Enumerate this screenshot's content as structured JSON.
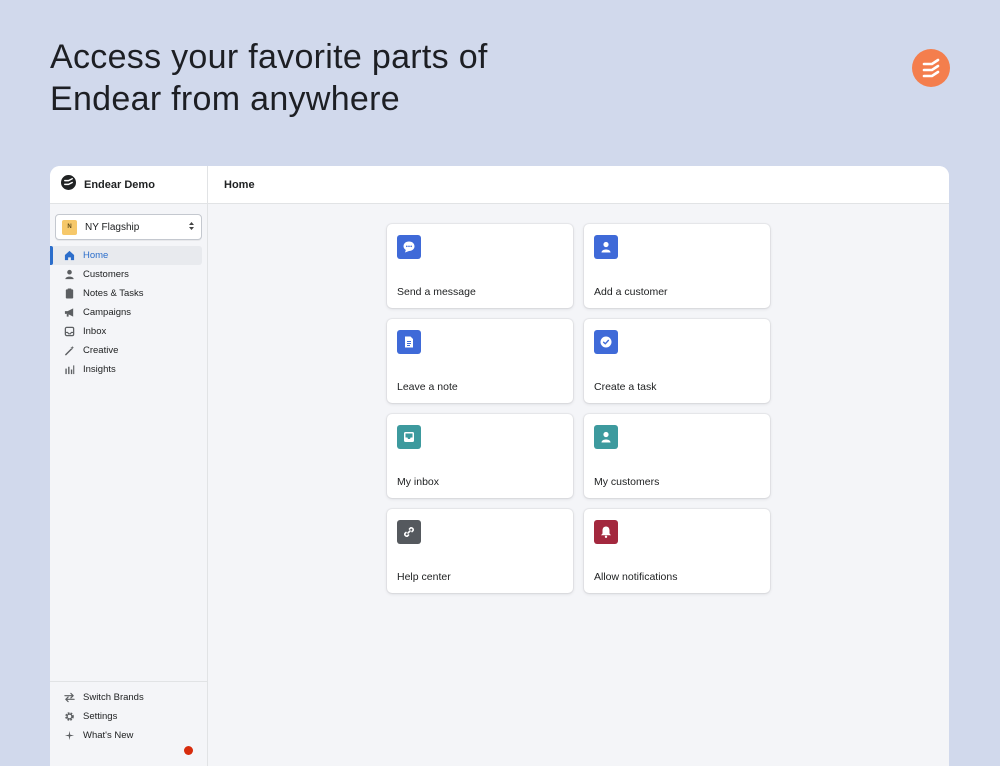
{
  "headline": {
    "line1": "Access your favorite parts of",
    "line2": "Endear from anywhere"
  },
  "brand_color": "#f47e4d",
  "sidebar": {
    "app_name": "Endear Demo",
    "store": {
      "initial": "N",
      "name": "NY Flagship"
    },
    "items": [
      {
        "label": "Home",
        "icon": "home-icon"
      },
      {
        "label": "Customers",
        "icon": "person-icon"
      },
      {
        "label": "Notes & Tasks",
        "icon": "clipboard-icon"
      },
      {
        "label": "Campaigns",
        "icon": "megaphone-icon"
      },
      {
        "label": "Inbox",
        "icon": "inbox-icon"
      },
      {
        "label": "Creative",
        "icon": "magic-wand-icon"
      },
      {
        "label": "Insights",
        "icon": "bar-chart-icon"
      }
    ],
    "footer_items": [
      {
        "label": "Switch Brands",
        "icon": "swap-arrows-icon"
      },
      {
        "label": "Settings",
        "icon": "gear-icon"
      },
      {
        "label": "What's New",
        "icon": "sparkle-icon"
      }
    ]
  },
  "main": {
    "title": "Home",
    "cards": [
      {
        "label": "Send a message",
        "icon": "chat-bubble-icon",
        "color": "#3f6ad8"
      },
      {
        "label": "Add a customer",
        "icon": "person-icon",
        "color": "#3f6ad8"
      },
      {
        "label": "Leave a note",
        "icon": "document-icon",
        "color": "#3f6ad8"
      },
      {
        "label": "Create a task",
        "icon": "checkmark-circle-icon",
        "color": "#3f6ad8"
      },
      {
        "label": "My inbox",
        "icon": "inbox-icon",
        "color": "#3d9a9e"
      },
      {
        "label": "My customers",
        "icon": "person-icon",
        "color": "#3d9a9e"
      },
      {
        "label": "Help center",
        "icon": "link-icon",
        "color": "#55595e"
      },
      {
        "label": "Allow notifications",
        "icon": "bell-icon",
        "color": "#a3283e"
      }
    ]
  }
}
